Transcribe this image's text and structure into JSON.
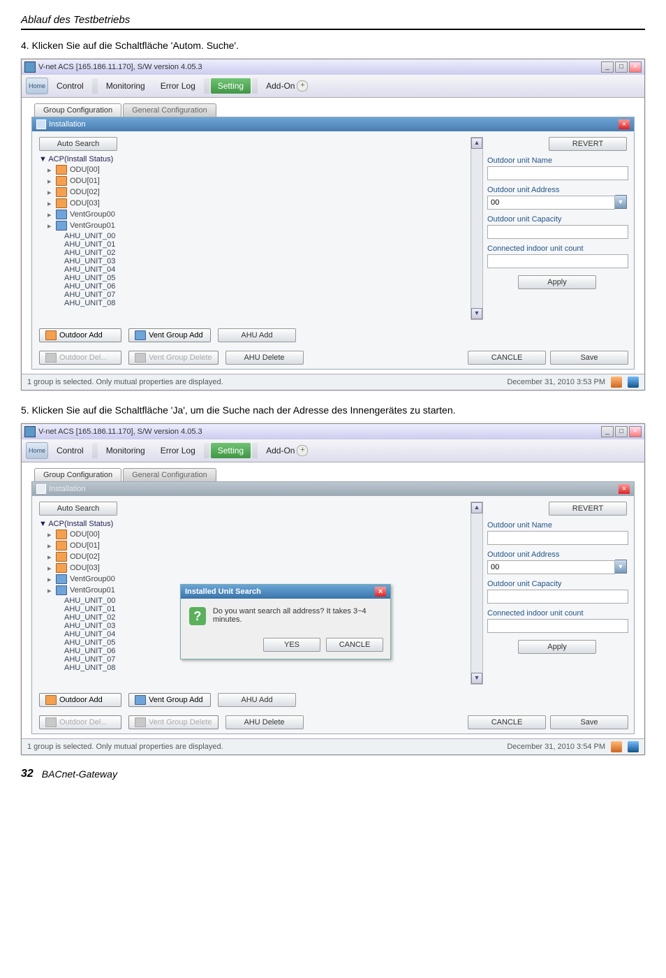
{
  "page": {
    "header": "Ablauf des Testbetriebs",
    "step4": "4. Klicken Sie auf die Schaltfläche 'Autom. Suche'.",
    "step5": "5. Klicken Sie auf die Schaltfläche 'Ja', um die Suche nach der Adresse des Innengerätes zu starten.",
    "footer_num": "32",
    "footer_name": "BACnet-Gateway"
  },
  "window1": {
    "title": "V-net ACS [165.186.11.170],   S/W version 4.05.3",
    "nav": {
      "home": "Home",
      "control": "Control",
      "monitoring": "Monitoring",
      "errorlog": "Error Log",
      "setting": "Setting",
      "addon": "Add-On"
    },
    "subtabs": {
      "group": "Group Configuration",
      "general": "General Configuration"
    },
    "panel_title": "Installation",
    "auto_search": "Auto Search",
    "revert": "REVERT",
    "tree_root": "▼ ACP(Install Status)",
    "odu": [
      "ODU[00]",
      "ODU[01]",
      "ODU[02]",
      "ODU[03]"
    ],
    "vent": [
      "VentGroup00",
      "VentGroup01"
    ],
    "ahu": [
      "AHU_UNIT_00",
      "AHU_UNIT_01",
      "AHU_UNIT_02",
      "AHU_UNIT_03",
      "AHU_UNIT_04",
      "AHU_UNIT_05",
      "AHU_UNIT_06",
      "AHU_UNIT_07",
      "AHU_UNIT_08"
    ],
    "form": {
      "name": "Outdoor unit Name",
      "address": "Outdoor unit Address",
      "address_value": "00",
      "capacity": "Outdoor unit Capacity",
      "connected": "Connected indoor unit count",
      "apply": "Apply"
    },
    "bottom": {
      "outdoor_add": "Outdoor Add",
      "vent_add": "Vent Group Add",
      "ahu_add": "AHU Add",
      "outdoor_del": "Outdoor Del...",
      "vent_del": "Vent Group Delete",
      "ahu_del": "AHU Delete",
      "cancel": "CANCLE",
      "save": "Save"
    },
    "status": "1 group is selected. Only mutual properties are displayed.",
    "datetime": "December 31, 2010  3:53 PM"
  },
  "window2": {
    "title": "V-net ACS [165.186.11.170],   S/W version 4.05.3",
    "panel_title": "Installation",
    "dialog": {
      "title": "Installed Unit Search",
      "msg": "Do you want search all address? It takes 3~4 minutes.",
      "yes": "YES",
      "cancel": "CANCLE"
    },
    "datetime": "December 31, 2010  3:54 PM"
  }
}
